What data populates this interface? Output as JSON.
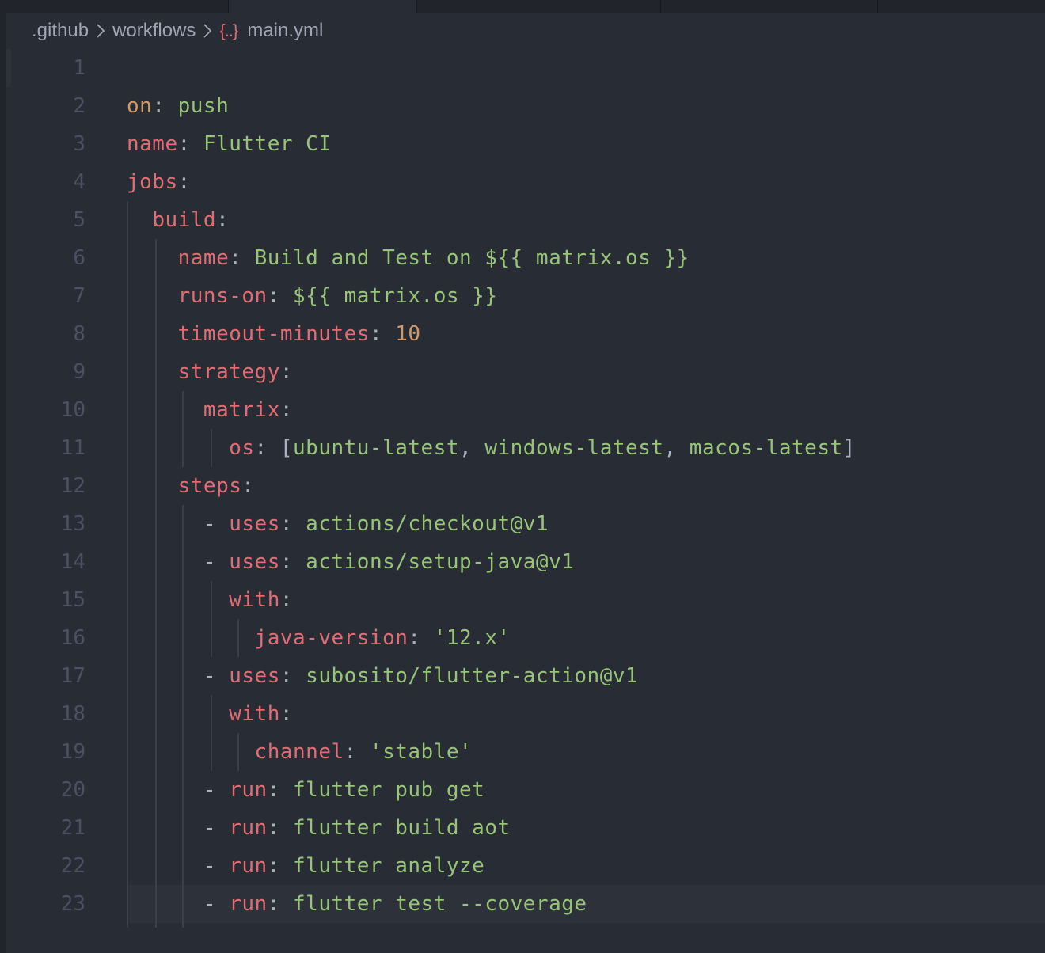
{
  "breadcrumb": {
    "items": [
      ".github",
      "workflows",
      "main.yml"
    ],
    "file_icon": "{..}"
  },
  "editor": {
    "language": "yaml",
    "current_line": 23,
    "lines": [
      {
        "num": "1",
        "indent": "",
        "tokens": []
      },
      {
        "num": "2",
        "indent": "",
        "tokens": [
          {
            "t": "on",
            "c": "n"
          },
          {
            "t": ": ",
            "c": "p"
          },
          {
            "t": "push",
            "c": "s"
          }
        ]
      },
      {
        "num": "3",
        "indent": "",
        "tokens": [
          {
            "t": "name",
            "c": "k"
          },
          {
            "t": ": ",
            "c": "p"
          },
          {
            "t": "Flutter CI",
            "c": "s"
          }
        ]
      },
      {
        "num": "4",
        "indent": "",
        "tokens": [
          {
            "t": "jobs",
            "c": "k"
          },
          {
            "t": ":",
            "c": "p"
          }
        ]
      },
      {
        "num": "5",
        "indent": "  ",
        "tokens": [
          {
            "t": "build",
            "c": "k"
          },
          {
            "t": ":",
            "c": "p"
          }
        ]
      },
      {
        "num": "6",
        "indent": "    ",
        "tokens": [
          {
            "t": "name",
            "c": "k"
          },
          {
            "t": ": ",
            "c": "p"
          },
          {
            "t": "Build and Test on ${{ matrix.os }}",
            "c": "s"
          }
        ]
      },
      {
        "num": "7",
        "indent": "    ",
        "tokens": [
          {
            "t": "runs-on",
            "c": "k"
          },
          {
            "t": ": ",
            "c": "p"
          },
          {
            "t": "${{ matrix.os }}",
            "c": "s"
          }
        ]
      },
      {
        "num": "8",
        "indent": "    ",
        "tokens": [
          {
            "t": "timeout-minutes",
            "c": "k"
          },
          {
            "t": ": ",
            "c": "p"
          },
          {
            "t": "10",
            "c": "n"
          }
        ]
      },
      {
        "num": "9",
        "indent": "    ",
        "tokens": [
          {
            "t": "strategy",
            "c": "k"
          },
          {
            "t": ":",
            "c": "p"
          }
        ]
      },
      {
        "num": "10",
        "indent": "      ",
        "tokens": [
          {
            "t": "matrix",
            "c": "k"
          },
          {
            "t": ":",
            "c": "p"
          }
        ]
      },
      {
        "num": "11",
        "indent": "        ",
        "tokens": [
          {
            "t": "os",
            "c": "k"
          },
          {
            "t": ": [",
            "c": "p"
          },
          {
            "t": "ubuntu-latest",
            "c": "s"
          },
          {
            "t": ", ",
            "c": "p"
          },
          {
            "t": "windows-latest",
            "c": "s"
          },
          {
            "t": ", ",
            "c": "p"
          },
          {
            "t": "macos-latest",
            "c": "s"
          },
          {
            "t": "]",
            "c": "p"
          }
        ]
      },
      {
        "num": "12",
        "indent": "    ",
        "tokens": [
          {
            "t": "steps",
            "c": "k"
          },
          {
            "t": ":",
            "c": "p"
          }
        ]
      },
      {
        "num": "13",
        "indent": "      ",
        "tokens": [
          {
            "t": "- ",
            "c": "p"
          },
          {
            "t": "uses",
            "c": "k"
          },
          {
            "t": ": ",
            "c": "p"
          },
          {
            "t": "actions/checkout@v1",
            "c": "s"
          }
        ]
      },
      {
        "num": "14",
        "indent": "      ",
        "tokens": [
          {
            "t": "- ",
            "c": "p"
          },
          {
            "t": "uses",
            "c": "k"
          },
          {
            "t": ": ",
            "c": "p"
          },
          {
            "t": "actions/setup-java@v1",
            "c": "s"
          }
        ]
      },
      {
        "num": "15",
        "indent": "        ",
        "tokens": [
          {
            "t": "with",
            "c": "k"
          },
          {
            "t": ":",
            "c": "p"
          }
        ]
      },
      {
        "num": "16",
        "indent": "          ",
        "tokens": [
          {
            "t": "java-version",
            "c": "k"
          },
          {
            "t": ": ",
            "c": "p"
          },
          {
            "t": "'12.x'",
            "c": "s"
          }
        ]
      },
      {
        "num": "17",
        "indent": "      ",
        "tokens": [
          {
            "t": "- ",
            "c": "p"
          },
          {
            "t": "uses",
            "c": "k"
          },
          {
            "t": ": ",
            "c": "p"
          },
          {
            "t": "subosito/flutter-action@v1",
            "c": "s"
          }
        ]
      },
      {
        "num": "18",
        "indent": "        ",
        "tokens": [
          {
            "t": "with",
            "c": "k"
          },
          {
            "t": ":",
            "c": "p"
          }
        ]
      },
      {
        "num": "19",
        "indent": "          ",
        "tokens": [
          {
            "t": "channel",
            "c": "k"
          },
          {
            "t": ": ",
            "c": "p"
          },
          {
            "t": "'stable'",
            "c": "s"
          }
        ]
      },
      {
        "num": "20",
        "indent": "      ",
        "tokens": [
          {
            "t": "- ",
            "c": "p"
          },
          {
            "t": "run",
            "c": "k"
          },
          {
            "t": ": ",
            "c": "p"
          },
          {
            "t": "flutter pub get",
            "c": "s"
          }
        ]
      },
      {
        "num": "21",
        "indent": "      ",
        "tokens": [
          {
            "t": "- ",
            "c": "p"
          },
          {
            "t": "run",
            "c": "k"
          },
          {
            "t": ": ",
            "c": "p"
          },
          {
            "t": "flutter build aot",
            "c": "s"
          }
        ]
      },
      {
        "num": "22",
        "indent": "      ",
        "tokens": [
          {
            "t": "- ",
            "c": "p"
          },
          {
            "t": "run",
            "c": "k"
          },
          {
            "t": ": ",
            "c": "p"
          },
          {
            "t": "flutter analyze",
            "c": "s"
          }
        ]
      },
      {
        "num": "23",
        "indent": "      ",
        "tokens": [
          {
            "t": "- ",
            "c": "p"
          },
          {
            "t": "run",
            "c": "k"
          },
          {
            "t": ": ",
            "c": "p"
          },
          {
            "t": "flutter test --coverage",
            "c": "s"
          }
        ]
      }
    ]
  },
  "colors": {
    "background": "#282c34",
    "key": "#e06c75",
    "string": "#98c379",
    "number": "#d19a66",
    "punctuation": "#abb2bf",
    "line_number": "#495162",
    "icon": "#e06c75"
  }
}
